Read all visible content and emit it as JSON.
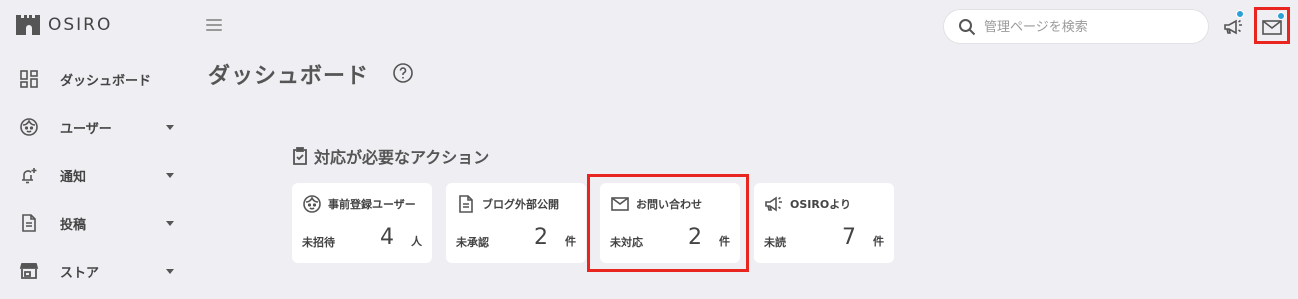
{
  "app": {
    "logo_text": "OSIRO"
  },
  "sidebar": {
    "items": [
      {
        "label": "ダッシュボード",
        "icon": "dashboard-icon",
        "has_caret": false
      },
      {
        "label": "ユーザー",
        "icon": "user-face-icon",
        "has_caret": true
      },
      {
        "label": "通知",
        "icon": "bell-add-icon",
        "has_caret": true
      },
      {
        "label": "投稿",
        "icon": "document-icon",
        "has_caret": true
      },
      {
        "label": "ストア",
        "icon": "store-icon",
        "has_caret": true
      }
    ]
  },
  "header": {
    "search_placeholder": "管理ページを検索",
    "announcement_icon": "megaphone-icon",
    "mail_icon": "mail-icon",
    "notification_dot_color": "#2ba0d8",
    "highlight_color": "#e8261f"
  },
  "main": {
    "title": "ダッシュボード",
    "section_title": "対応が必要なアクション",
    "cards": [
      {
        "title": "事前登録ユーザー",
        "icon": "user-face-icon",
        "status": "未招待",
        "count": "4",
        "unit": "人"
      },
      {
        "title": "ブログ外部公開",
        "icon": "document-icon",
        "status": "未承認",
        "count": "2",
        "unit": "件"
      },
      {
        "title": "お問い合わせ",
        "icon": "mail-icon",
        "status": "未対応",
        "count": "2",
        "unit": "件"
      },
      {
        "title": "OSIROより",
        "icon": "megaphone-icon",
        "status": "未読",
        "count": "7",
        "unit": "件"
      }
    ]
  }
}
